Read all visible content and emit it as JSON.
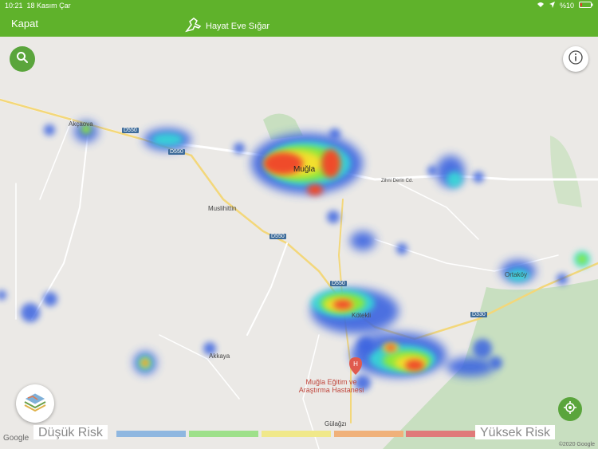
{
  "status": {
    "time": "10:21",
    "date": "18 Kasım Çar",
    "battery": "%10"
  },
  "navbar": {
    "close_label": "Kapat",
    "title": "Hayat Eve Sığar"
  },
  "legend": {
    "low_label": "Düşük Risk",
    "high_label": "Yüksek Risk",
    "colors": [
      "#8fb7e0",
      "#9ee08a",
      "#f0e88a",
      "#f0b17a",
      "#e07a7a"
    ]
  },
  "map": {
    "labels": {
      "mugla": "Muğla",
      "akcaova": "Akçaova",
      "muslihittin": "Muslihittin",
      "akkaya": "Akkaya",
      "ortakoy": "Ortaköy",
      "kotekli": "Kötekli",
      "gulagzi": "Gülağzı",
      "hospital": "Muğla Eğitim ve Araştırma Hastanesi",
      "zihni": "Zihni Derin Cd."
    },
    "roads": [
      "D550",
      "D550",
      "D550",
      "D550",
      "D330"
    ],
    "attribution": "Google",
    "copyright": "©2020 Google"
  },
  "icons": {
    "search": "search-icon",
    "info": "info-icon",
    "layers": "layers-icon",
    "locate": "locate-icon",
    "hospital": "hospital-pin-icon"
  }
}
